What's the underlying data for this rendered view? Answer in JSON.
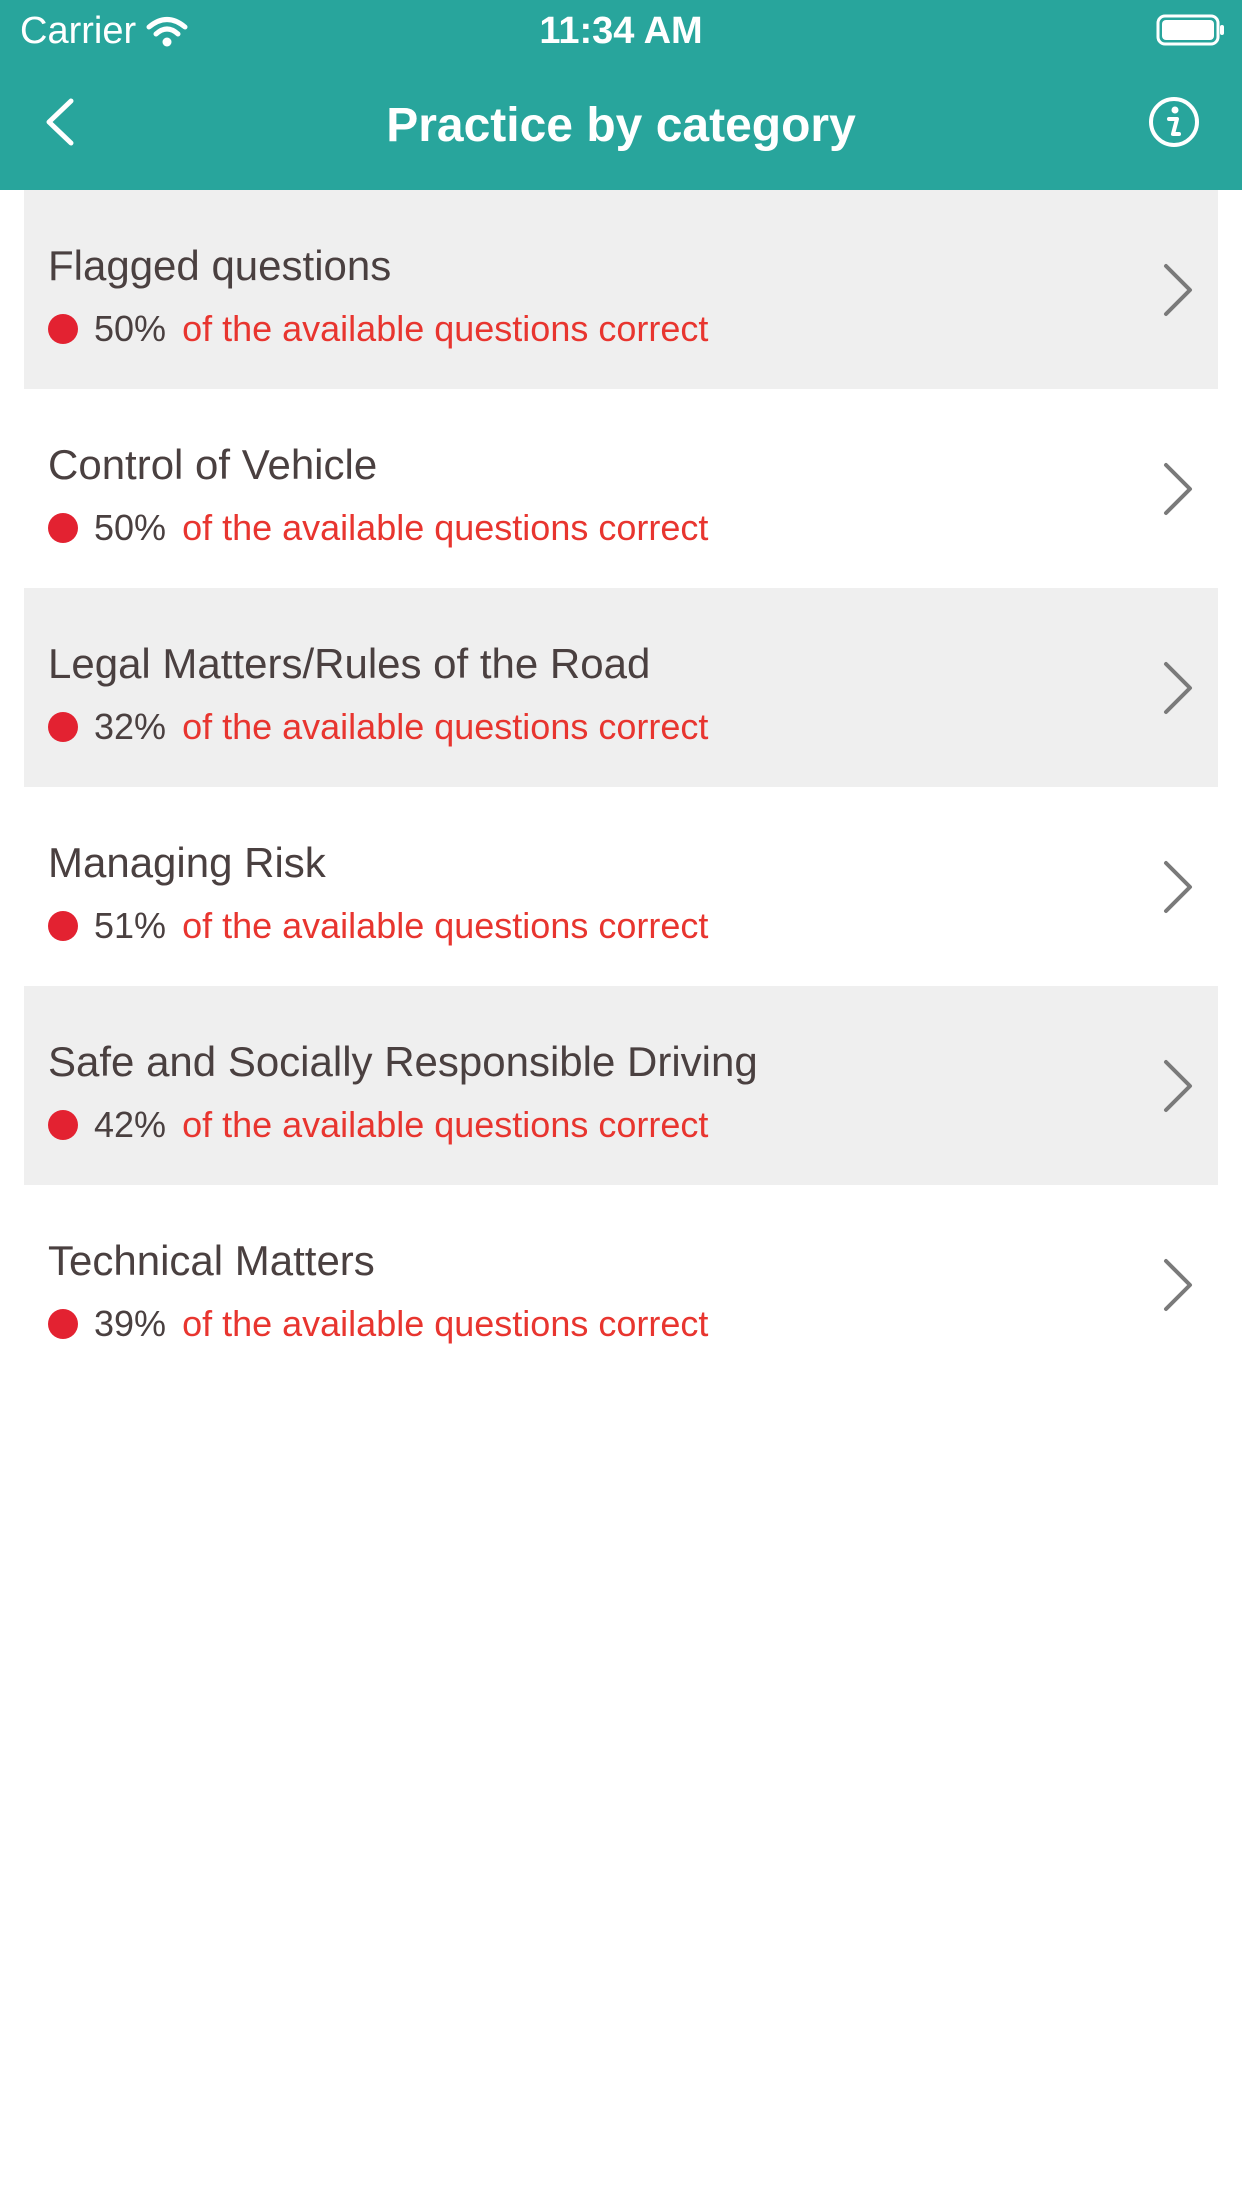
{
  "status_bar": {
    "carrier": "Carrier",
    "time": "11:34 AM"
  },
  "nav": {
    "title": "Practice by category",
    "back_icon": "chevron-left-icon",
    "info_icon": "info-icon"
  },
  "colors": {
    "header": "#28a59c",
    "status_dot": "#e32231",
    "suffix_text": "#e8352f",
    "shaded_row": "#efefef"
  },
  "categories": [
    {
      "title": "Flagged questions",
      "percent": "50%",
      "suffix": "of the available questions correct"
    },
    {
      "title": "Control of Vehicle",
      "percent": "50%",
      "suffix": "of the available questions correct"
    },
    {
      "title": "Legal Matters/Rules of the Road",
      "percent": "32%",
      "suffix": "of the available questions correct"
    },
    {
      "title": "Managing Risk",
      "percent": "51%",
      "suffix": "of the available questions correct"
    },
    {
      "title": "Safe and Socially Responsible Driving",
      "percent": "42%",
      "suffix": "of the available questions correct"
    },
    {
      "title": "Technical Matters",
      "percent": "39%",
      "suffix": "of the available questions correct"
    }
  ]
}
